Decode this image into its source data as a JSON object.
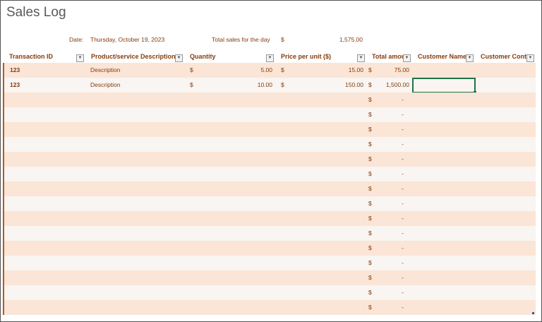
{
  "title": "Sales Log",
  "meta": {
    "date_label": "Date:",
    "date_value": "Thursday, October 19, 2023",
    "total_label": "Total sales for the day",
    "total_currency": "$",
    "total_value": "1,575.00"
  },
  "columns": [
    "Transaction ID",
    "Product/service Description",
    "Quantity",
    "Price per unit ($)",
    "Total amou",
    "Customer Name",
    "Customer Contac"
  ],
  "rows": [
    {
      "id": "123",
      "desc": "Description",
      "qty_cur": "$",
      "qty": "5.00",
      "price_cur": "$",
      "price": "15.00",
      "total_cur": "$",
      "total": "75.00"
    },
    {
      "id": "123",
      "desc": "Description",
      "qty_cur": "$",
      "qty": "10.00",
      "price_cur": "$",
      "price": "150.00",
      "total_cur": "$",
      "total": "1,500.00"
    }
  ],
  "empty_row": {
    "total_cur": "$",
    "total": "-"
  },
  "empty_row_count": 15,
  "colors": {
    "header_text": "#843c0c",
    "row_odd": "#fbe5d6",
    "row_even": "#f8f5f2",
    "selection": "#217346"
  }
}
